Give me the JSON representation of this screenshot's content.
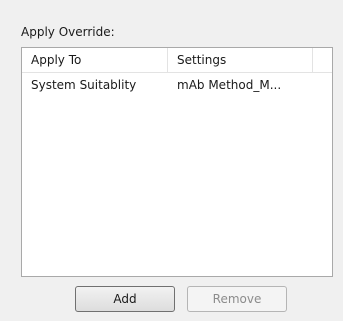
{
  "override": {
    "label": "Apply Override:",
    "columns": [
      "Apply To",
      "Settings"
    ],
    "rows": [
      {
        "apply_to": "System Suitablity",
        "settings": "mAb Method_M..."
      }
    ],
    "add_label": "Add",
    "remove_label": "Remove"
  }
}
